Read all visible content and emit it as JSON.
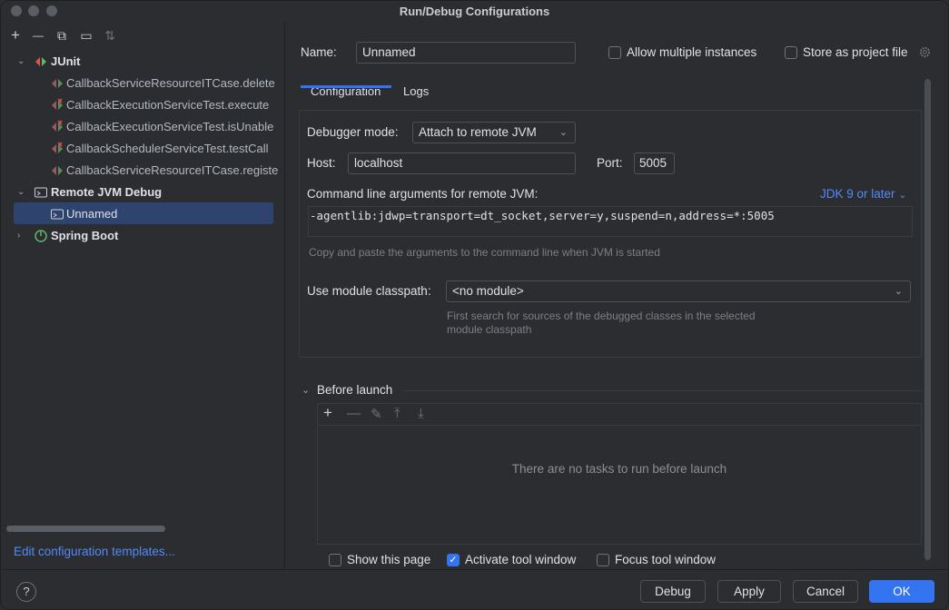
{
  "window": {
    "title": "Run/Debug Configurations"
  },
  "left_toolbar": {
    "add": "+",
    "remove": "—",
    "copy": "⧉",
    "folder": "▭",
    "sort": "⇅"
  },
  "tree": {
    "junit": {
      "label": "JUnit",
      "items": [
        "CallbackServiceResourceITCase.delete",
        "CallbackExecutionServiceTest.execute",
        "CallbackExecutionServiceTest.isUnable",
        "CallbackSchedulerServiceTest.testCall",
        "CallbackServiceResourceITCase.registe"
      ]
    },
    "remote": {
      "label": "Remote JVM Debug",
      "items": [
        "Unnamed"
      ]
    },
    "spring": {
      "label": "Spring Boot"
    }
  },
  "edit_templates": "Edit configuration templates...",
  "form": {
    "name_label": "Name:",
    "name_value": "Unnamed",
    "allow_multiple": "Allow multiple instances",
    "store_project": "Store as project file",
    "tabs": [
      "Configuration",
      "Logs"
    ],
    "debugger_mode_label": "Debugger mode:",
    "debugger_mode_value": "Attach to remote JVM",
    "host_label": "Host:",
    "host_value": "localhost",
    "port_label": "Port:",
    "port_value": "5005",
    "cmd_label": "Command line arguments for remote JVM:",
    "jdk_link": "JDK 9 or later",
    "cmd_value": "-agentlib:jdwp=transport=dt_socket,server=y,suspend=n,address=*:5005",
    "cmd_hint": "Copy and paste the arguments to the command line when JVM is started",
    "module_label": "Use module classpath:",
    "module_value": "<no module>",
    "module_hint_1": "First search for sources of the debugged classes in the selected",
    "module_hint_2": "module classpath"
  },
  "before_launch": {
    "label": "Before launch",
    "empty": "There are no tasks to run before launch",
    "show_page": "Show this page",
    "activate_tool": "Activate tool window",
    "focus_tool": "Focus tool window"
  },
  "buttons": {
    "help": "?",
    "debug": "Debug",
    "apply": "Apply",
    "cancel": "Cancel",
    "ok": "OK"
  },
  "colors": {
    "accent": "#3574f0",
    "link": "#548af7",
    "background": "#2b2d30",
    "selection": "#2e436e"
  }
}
